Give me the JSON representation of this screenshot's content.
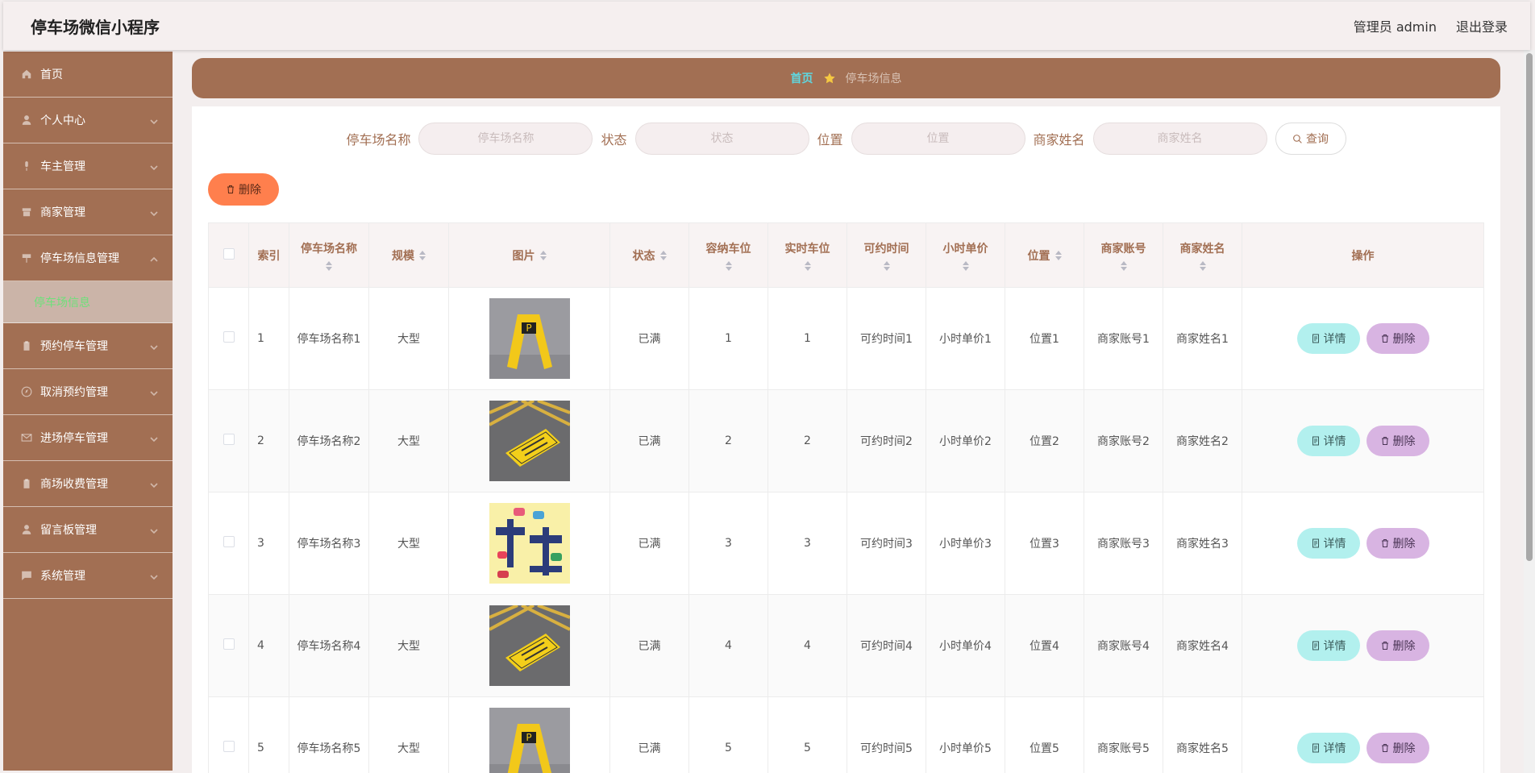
{
  "header": {
    "app_title": "停车场微信小程序",
    "user_label": "管理员 admin",
    "logout_label": "退出登录"
  },
  "sidebar": {
    "items": [
      {
        "label": "首页",
        "icon": "home-icon"
      },
      {
        "label": "个人中心",
        "icon": "user-icon"
      },
      {
        "label": "车主管理",
        "icon": "mic-icon"
      },
      {
        "label": "商家管理",
        "icon": "shop-icon"
      },
      {
        "label": "停车场信息管理",
        "icon": "sign-icon",
        "expanded": true
      },
      {
        "label": "预约停车管理",
        "icon": "clipboard-icon"
      },
      {
        "label": "取消预约管理",
        "icon": "compass-icon"
      },
      {
        "label": "进场停车管理",
        "icon": "mail-icon"
      },
      {
        "label": "商场收费管理",
        "icon": "clipboard-icon"
      },
      {
        "label": "留言板管理",
        "icon": "user-icon"
      },
      {
        "label": "系统管理",
        "icon": "chat-icon"
      }
    ],
    "active_sub": "停车场信息"
  },
  "breadcrumb": {
    "home": "首页",
    "current": "停车场信息"
  },
  "search": {
    "fields": [
      {
        "label": "停车场名称",
        "placeholder": "停车场名称"
      },
      {
        "label": "状态",
        "placeholder": "状态"
      },
      {
        "label": "位置",
        "placeholder": "位置"
      },
      {
        "label": "商家姓名",
        "placeholder": "商家姓名"
      }
    ],
    "button": "查询"
  },
  "toolbar": {
    "delete_label": "删除"
  },
  "table": {
    "headers": [
      "索引",
      "停车场名称",
      "规模",
      "图片",
      "状态",
      "容纳车位",
      "实时车位",
      "可约时间",
      "小时单价",
      "位置",
      "商家账号",
      "商家姓名",
      "操作"
    ],
    "rows": [
      {
        "index": "1",
        "name": "停车场名称1",
        "scale": "大型",
        "image": "sign",
        "status": "已满",
        "capacity": "1",
        "realtime": "1",
        "time": "可约时间1",
        "price": "小时单价1",
        "location": "位置1",
        "account": "商家账号1",
        "merchant": "商家姓名1"
      },
      {
        "index": "2",
        "name": "停车场名称2",
        "scale": "大型",
        "image": "floor",
        "status": "已满",
        "capacity": "2",
        "realtime": "2",
        "time": "可约时间2",
        "price": "小时单价2",
        "location": "位置2",
        "account": "商家账号2",
        "merchant": "商家姓名2"
      },
      {
        "index": "3",
        "name": "停车场名称3",
        "scale": "大型",
        "image": "cartoon",
        "status": "已满",
        "capacity": "3",
        "realtime": "3",
        "time": "可约时间3",
        "price": "小时单价3",
        "location": "位置3",
        "account": "商家账号3",
        "merchant": "商家姓名3"
      },
      {
        "index": "4",
        "name": "停车场名称4",
        "scale": "大型",
        "image": "floor",
        "status": "已满",
        "capacity": "4",
        "realtime": "4",
        "time": "可约时间4",
        "price": "小时单价4",
        "location": "位置4",
        "account": "商家账号4",
        "merchant": "商家姓名4"
      },
      {
        "index": "5",
        "name": "停车场名称5",
        "scale": "大型",
        "image": "sign",
        "status": "已满",
        "capacity": "5",
        "realtime": "5",
        "time": "可约时间5",
        "price": "小时单价5",
        "location": "位置5",
        "account": "商家账号5",
        "merchant": "商家姓名5"
      }
    ],
    "detail_label": "详情",
    "delete_label": "删除"
  },
  "colors": {
    "brand": "#a26f53",
    "delete_top": "#ff7f4d",
    "detail": "#b2f0ee",
    "delete_row": "#d8b4e2",
    "active_sub": "#6ee07a"
  }
}
